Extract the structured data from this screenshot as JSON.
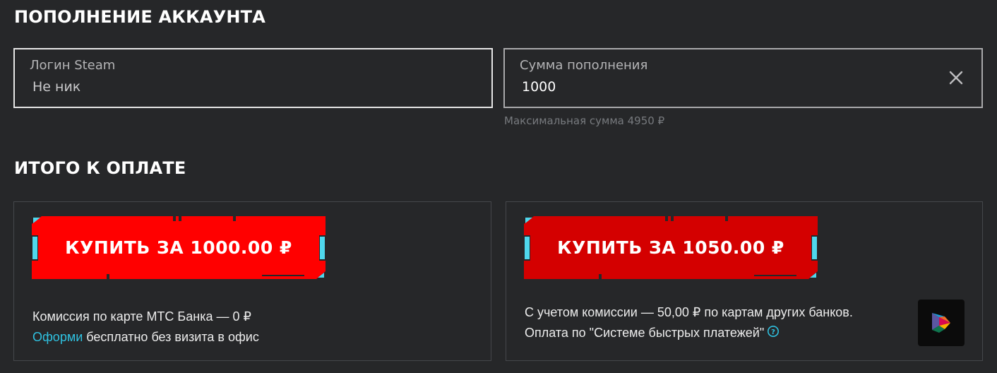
{
  "topup": {
    "title": "ПОПОЛНЕНИЕ АККАУНТА",
    "login": {
      "label": "Логин Steam",
      "value": "Не ник"
    },
    "amount": {
      "label": "Сумма пополнения",
      "value": "1000"
    },
    "hint": "Максимальная сумма 4950 ₽"
  },
  "total": {
    "title": "ИТОГО К ОПЛАТЕ",
    "mts": {
      "button_label": "КУПИТЬ ЗА 1000.00 ₽",
      "button_color": "#ff0000",
      "commission": "Комиссия по карте МТС Банка — 0 ₽",
      "link": "Оформи",
      "link_tail": " бесплатно без визита в офис"
    },
    "sbp": {
      "button_label": "КУПИТЬ ЗА 1050.00 ₽",
      "button_color": "#d40000",
      "commission": "С учетом комиссии — 50,00 ₽ по картам других банков.",
      "payment": "Оплата по \"Системе быстрых платежей\""
    }
  },
  "colors": {
    "background": "#262729",
    "accent_cyan": "#2fc1e0",
    "red": "#ff0000"
  },
  "icons": {
    "clear": "close-icon",
    "help": "question-circle-icon",
    "sbp": "sbp-logo-icon"
  }
}
